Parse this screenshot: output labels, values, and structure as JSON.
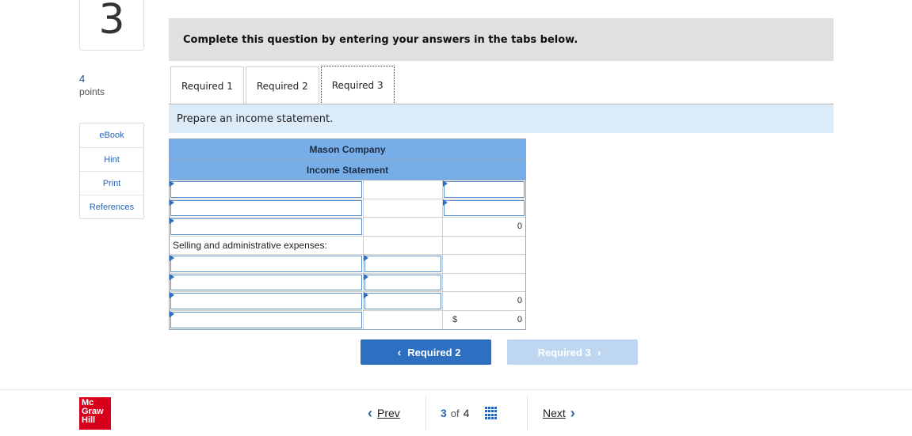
{
  "question": {
    "number": "3",
    "points_value": "4",
    "points_label": "points"
  },
  "side_tools": [
    "eBook",
    "Hint",
    "Print",
    "References"
  ],
  "banner": {
    "text": "Complete this question by entering your answers in the tabs below."
  },
  "tabs": [
    {
      "label": "Required 1",
      "active": false
    },
    {
      "label": "Required 2",
      "active": false
    },
    {
      "label": "Required 3",
      "active": true
    }
  ],
  "instruction": "Prepare an income statement.",
  "statement": {
    "company": "Mason Company",
    "title": "Income Statement",
    "rows": [
      {
        "label": "",
        "col2": "",
        "col3": ""
      },
      {
        "label": "",
        "col2": "",
        "col3": ""
      },
      {
        "label": "",
        "col2": "",
        "col3": "0"
      },
      {
        "label": "Selling and administrative expenses:",
        "col2": "",
        "col3": ""
      },
      {
        "label": "",
        "col2": "",
        "col3": ""
      },
      {
        "label": "",
        "col2": "",
        "col3": ""
      },
      {
        "label": "",
        "col2": "",
        "col3": "0"
      },
      {
        "label": "",
        "col2": "",
        "col3": "0",
        "currency": "$"
      }
    ]
  },
  "buttons": {
    "prev_required": "Required 2",
    "next_required": "Required 3"
  },
  "logo": {
    "line1": "Mc",
    "line2": "Graw",
    "line3": "Hill"
  },
  "nav": {
    "prev": "Prev",
    "current": "3",
    "of": "of",
    "total": "4",
    "next": "Next"
  },
  "colors": {
    "accent": "#2d6fc0",
    "header_blue": "#78aee8",
    "instruction_bg": "#dcebf8",
    "logo_red": "#d6001c"
  }
}
